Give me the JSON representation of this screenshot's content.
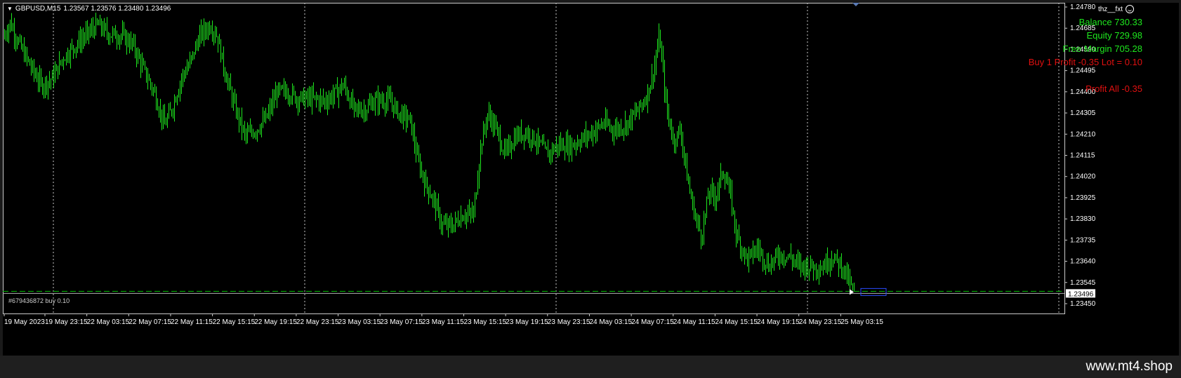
{
  "symbol": {
    "label": "GBPUSD,M15",
    "ohlc": "1.23567 1.23576 1.23480 1.23496"
  },
  "ea_name": "thz__fxt",
  "account": {
    "balance": "Balance 730.33",
    "equity": "Equity 729.98",
    "free_margin": "Free Margin 705.28",
    "position": "Buy 1   Profit -0.35  Lot = 0.10",
    "profit_all": "Profit All -0.35"
  },
  "order_line_label": "#679436872 buy 0.10",
  "brand": "www.mt4.shop",
  "colors": {
    "background": "#000000",
    "candles": "#1ee81e",
    "grid": "#c8c8c8",
    "positive_text": "#1ee81e",
    "negative_text": "#e01010",
    "current_price_box": "#ffffff",
    "order_line": "#00c000"
  },
  "price_axis": {
    "ticks": [
      "1.24780",
      "1.24685",
      "1.24590",
      "1.24495",
      "1.24400",
      "1.24305",
      "1.24210",
      "1.24115",
      "1.24020",
      "1.23925",
      "1.23830",
      "1.23735",
      "1.23640",
      "1.23545",
      "1.23450"
    ],
    "current": "1.23496"
  },
  "time_axis": {
    "ticks": [
      "19 May 2023",
      "19 May 23:15",
      "22 May 03:15",
      "22 May 07:15",
      "22 May 11:15",
      "22 May 15:15",
      "22 May 19:15",
      "22 May 23:15",
      "23 May 03:15",
      "23 May 07:15",
      "23 May 11:15",
      "23 May 15:15",
      "23 May 19:15",
      "23 May 23:15",
      "24 May 03:15",
      "24 May 07:15",
      "24 May 11:15",
      "24 May 15:15",
      "24 May 19:15",
      "24 May 23:15",
      "25 May 03:15"
    ]
  },
  "chart_data": {
    "type": "candlestick",
    "symbol": "GBPUSD",
    "timeframe": "M15",
    "ylim": [
      1.2345,
      1.2478
    ],
    "close_path": [
      [
        0,
        1.2464
      ],
      [
        10,
        1.2471
      ],
      [
        25,
        1.246
      ],
      [
        45,
        1.2448
      ],
      [
        55,
        1.2443
      ],
      [
        70,
        1.2446
      ],
      [
        85,
        1.2455
      ],
      [
        100,
        1.246
      ],
      [
        120,
        1.2466
      ],
      [
        135,
        1.247
      ],
      [
        150,
        1.2466
      ],
      [
        170,
        1.2465
      ],
      [
        185,
        1.2461
      ],
      [
        200,
        1.245
      ],
      [
        215,
        1.244
      ],
      [
        230,
        1.2425
      ],
      [
        240,
        1.2432
      ],
      [
        255,
        1.2447
      ],
      [
        265,
        1.2452
      ],
      [
        280,
        1.2465
      ],
      [
        295,
        1.247
      ],
      [
        305,
        1.2465
      ],
      [
        315,
        1.245
      ],
      [
        330,
        1.2433
      ],
      [
        345,
        1.242
      ],
      [
        360,
        1.2423
      ],
      [
        375,
        1.2428
      ],
      [
        390,
        1.244
      ],
      [
        405,
        1.244
      ],
      [
        420,
        1.2437
      ],
      [
        440,
        1.2437
      ],
      [
        460,
        1.2436
      ],
      [
        475,
        1.244
      ],
      [
        485,
        1.2443
      ],
      [
        500,
        1.2432
      ],
      [
        515,
        1.2432
      ],
      [
        530,
        1.2436
      ],
      [
        550,
        1.2436
      ],
      [
        565,
        1.243
      ],
      [
        580,
        1.2427
      ],
      [
        590,
        1.241
      ],
      [
        600,
        1.24
      ],
      [
        615,
        1.239
      ],
      [
        625,
        1.238
      ],
      [
        640,
        1.238
      ],
      [
        655,
        1.2385
      ],
      [
        670,
        1.2385
      ],
      [
        680,
        1.2415
      ],
      [
        690,
        1.243
      ],
      [
        700,
        1.2425
      ],
      [
        715,
        1.2412
      ],
      [
        730,
        1.242
      ],
      [
        745,
        1.2422
      ],
      [
        760,
        1.2418
      ],
      [
        775,
        1.2412
      ],
      [
        790,
        1.2416
      ],
      [
        810,
        1.2416
      ],
      [
        825,
        1.2419
      ],
      [
        840,
        1.2422
      ],
      [
        855,
        1.2426
      ],
      [
        870,
        1.2423
      ],
      [
        885,
        1.2425
      ],
      [
        900,
        1.243
      ],
      [
        915,
        1.2437
      ],
      [
        925,
        1.2447
      ],
      [
        935,
        1.2465
      ],
      [
        945,
        1.2432
      ],
      [
        955,
        1.2418
      ],
      [
        965,
        1.2423
      ],
      [
        975,
        1.24
      ],
      [
        985,
        1.2385
      ],
      [
        995,
        1.2375
      ],
      [
        1005,
        1.2395
      ],
      [
        1015,
        1.2393
      ],
      [
        1025,
        1.2405
      ],
      [
        1035,
        1.2395
      ],
      [
        1045,
        1.2375
      ],
      [
        1060,
        1.2365
      ],
      [
        1075,
        1.237
      ],
      [
        1090,
        1.2362
      ],
      [
        1105,
        1.2367
      ],
      [
        1120,
        1.2366
      ],
      [
        1135,
        1.2362
      ],
      [
        1150,
        1.2362
      ],
      [
        1165,
        1.2361
      ],
      [
        1180,
        1.2366
      ],
      [
        1195,
        1.2362
      ],
      [
        1205,
        1.2355
      ],
      [
        1212,
        1.23496
      ]
    ]
  }
}
